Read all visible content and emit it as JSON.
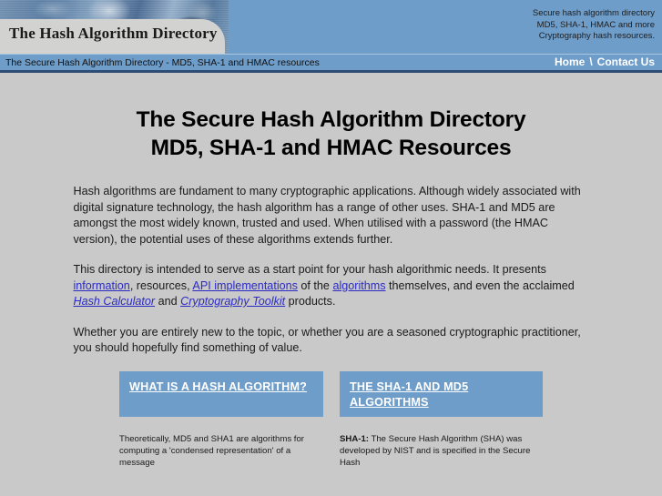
{
  "banner": {
    "site_title": "The Hash Algorithm Directory",
    "tagline_line1": "Secure hash algorithm directory",
    "tagline_line2": "MD5, SHA-1, HMAC and more",
    "tagline_line3": "Cryptography hash resources.",
    "photo_alt": "header-photo",
    "colors": {
      "banner_blue": "#6f9dc9",
      "panel_gray": "#d2d2d0"
    }
  },
  "nav": {
    "strapline": "The Secure Hash Algorithm Directory - MD5, SHA-1 and HMAC resources",
    "home_label": "Home",
    "separator": "\\",
    "contact_label": "Contact Us",
    "bar_color": "#6f9dc9",
    "rule_color": "#2e4c74"
  },
  "headings": {
    "line1": "The Secure Hash Algorithm Directory",
    "line2": "MD5, SHA-1 and HMAC Resources"
  },
  "content": {
    "para1": "Hash algorithms are fundament to many cryptographic applications. Although widely associated with digital signature technology, the hash algorithm has a range of other uses. SHA-1 and MD5 are amongst the most widely known, trusted and used. When utilised with a password (the HMAC version), the potential uses of these algorithms extends further.",
    "para2": {
      "seg1": "This directory is intended to serve as a start point for your hash algorithmic needs. It presents ",
      "link1": "information",
      "seg2": ", resources, ",
      "link2": "API implementations",
      "seg3": " of the ",
      "link3": "algorithms",
      "seg4": " themselves, and even the acclaimed ",
      "link4": "Hash Calculator",
      "seg5": " and ",
      "link5": "Cryptography Toolkit",
      "seg6": " products."
    },
    "para3": "Whether you are entirely new to the topic, or whether you are a seasoned cryptographic practitioner, you should hopefully find something of value.",
    "link_color": "#2b2bc4"
  },
  "feature_boxes": [
    {
      "title": "WHAT IS A HASH ALGORITHM?",
      "blurb": "Theoretically, MD5 and SHA1 are algorithms for computing a 'condensed representation' of a message",
      "color": "#6f9dc9"
    },
    {
      "title": "THE SHA-1 AND MD5 ALGORITHMS",
      "blurb_bold": "SHA-1:",
      "blurb": " The Secure Hash Algorithm (SHA) was developed by NIST and is specified in the Secure Hash",
      "color": "#6f9dc9"
    }
  ]
}
